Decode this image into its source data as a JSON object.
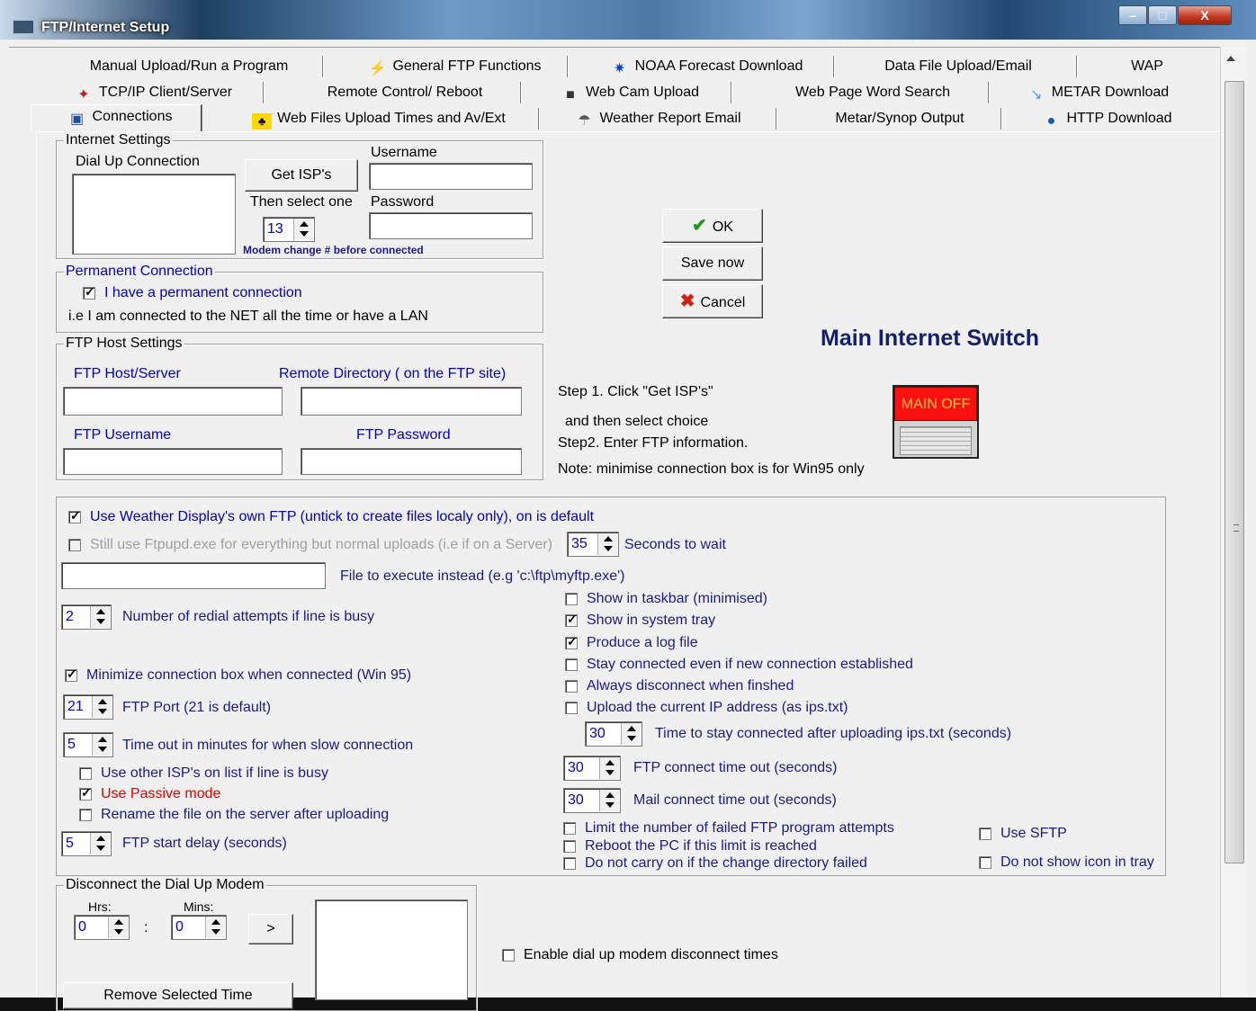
{
  "window": {
    "title": "FTP/Internet Setup",
    "min": "–",
    "max": "□",
    "close": "X"
  },
  "tabs": {
    "row1": [
      {
        "label": "Manual Upload/Run a Program",
        "icon": ""
      },
      {
        "label": "General FTP Functions",
        "icon": "lightning-icon"
      },
      {
        "label": "NOAA Forecast Download",
        "icon": "noaa-icon"
      },
      {
        "label": "Data File Upload/Email",
        "icon": ""
      },
      {
        "label": "WAP",
        "icon": ""
      }
    ],
    "row2": [
      {
        "label": "TCP/IP Client/Server",
        "icon": "network-icon"
      },
      {
        "label": "Remote Control/ Reboot",
        "icon": ""
      },
      {
        "label": "Web Cam Upload",
        "icon": "webcam-icon"
      },
      {
        "label": "Web Page Word Search",
        "icon": ""
      },
      {
        "label": "METAR Download",
        "icon": "metar-icon"
      }
    ],
    "row3": [
      {
        "label": "Connections",
        "icon": "connections-icon"
      },
      {
        "label": "Web Files Upload Times and  Av/Ext",
        "icon": "upload-times-icon"
      },
      {
        "label": "Weather Report Email",
        "icon": "weather-email-icon"
      },
      {
        "label": "Metar/Synop Output",
        "icon": ""
      },
      {
        "label": "HTTP Download",
        "icon": "globe-icon"
      }
    ]
  },
  "internet": {
    "group": "Internet Settings",
    "dialup_label": "Dial Up Connection",
    "get_isps": "Get ISP's",
    "then_select": "Then select one",
    "username_label": "Username",
    "password_label": "Password",
    "modem_value": "13",
    "modem_note": "Modem change # before connected"
  },
  "permanent": {
    "group": "Permanent Connection",
    "checkbox": "I have a permanent connection",
    "note": "i.e I am connected to the NET  all the time or have a LAN"
  },
  "ftp_host": {
    "group": "FTP Host Settings",
    "host": "FTP Host/Server",
    "remote_dir": "Remote Directory ( on the FTP site)",
    "user": "FTP Username",
    "pass": "FTP Password"
  },
  "buttons": {
    "ok": "OK",
    "save": "Save now",
    "cancel": "Cancel"
  },
  "main_switch": {
    "title": "Main Internet Switch",
    "state": "MAIN OFF"
  },
  "steps": {
    "s1": "Step 1. Click  \"Get ISP's\"",
    "s1b": "and then select choice",
    "s2": "Step2. Enter FTP information.",
    "note": "Note: minimise connection box is for Win95 only"
  },
  "options": {
    "own_ftp": "Use Weather Display's own FTP  (untick to create files localy only), on is default",
    "ftpupd": "Still use Ftpupd.exe for everything but normal uploads (i.e if on a Server)",
    "wait_value": "35",
    "wait_label": "Seconds to wait",
    "file_exec": "File to execute instead (e.g 'c:\\ftp\\myftp.exe')",
    "redial_value": "2",
    "redial_label": "Number of redial attempts if line is busy",
    "minimize_box": "Minimize connection box when connected (Win 95)",
    "port_value": "21",
    "port_label": "FTP Port (21 is default)",
    "timeout_value": "5",
    "timeout_label": "Time out in minutes for when slow connection",
    "other_isps": "Use other ISP's on list if line is busy",
    "passive": "Use Passive mode",
    "rename": "Rename the file on the server after uploading",
    "start_delay_value": "5",
    "start_delay_label": "FTP start delay (seconds)",
    "show_taskbar": "Show in taskbar (minimised)",
    "show_tray": "Show in system tray",
    "log_file": "Produce a log file",
    "stay_connected": "Stay connected even if new connection established",
    "always_disconnect": "Always disconnect when finshed",
    "upload_ip": "Upload the current IP address (as ips.txt)",
    "ips_time_value": "30",
    "ips_time_label": "Time to stay connected after uploading ips.txt (seconds)",
    "ftp_conn_value": "30",
    "ftp_conn_label": "FTP connect time out (seconds)",
    "mail_conn_value": "30",
    "mail_conn_label": "Mail connect time out (seconds)",
    "limit_failed": "Limit the number of failed FTP program attempts",
    "reboot_pc": "Reboot the PC if this limit is reached",
    "no_carry_on": "Do not carry on if the change directory failed",
    "use_sftp": "Use SFTP",
    "no_tray_icon": "Do not show icon in tray"
  },
  "disconnect": {
    "group": "Disconnect the Dial Up Modem",
    "hrs_label": "Hrs:",
    "mins_label": "Mins:",
    "hrs_value": "0",
    "mins_value": "0",
    "colon": ":",
    "add": ">",
    "remove": "Remove Selected Time",
    "enable": "Enable dial up modem disconnect times"
  }
}
